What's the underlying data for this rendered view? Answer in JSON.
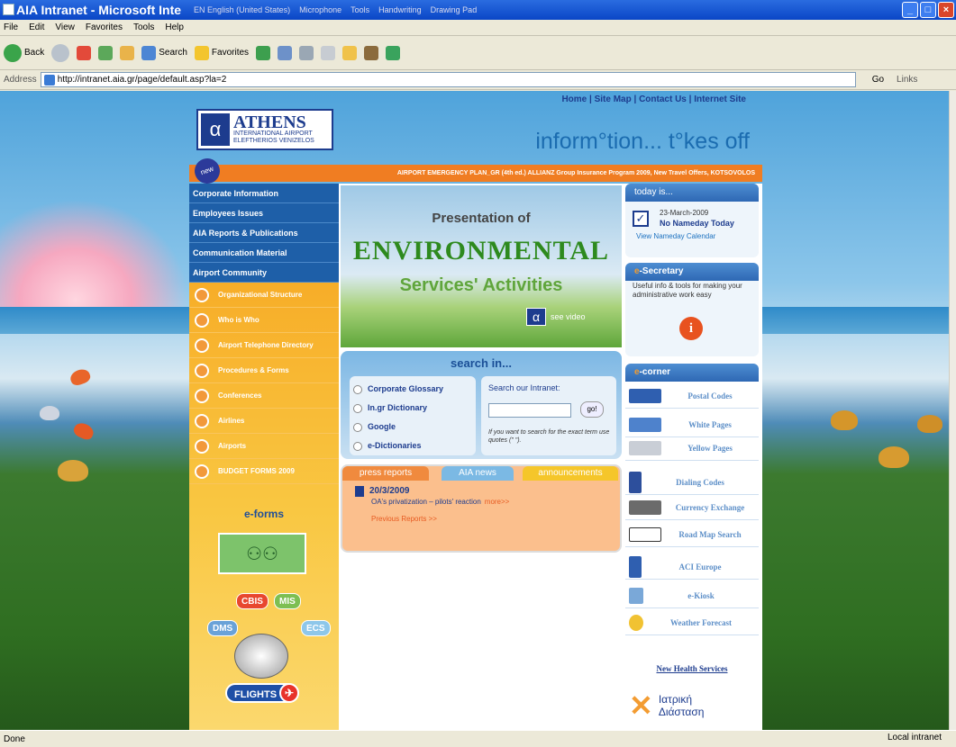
{
  "window": {
    "title": "AIA Intranet - Microsoft Inte",
    "language_bar": [
      "EN English (United States)",
      "Microphone",
      "Tools",
      "Handwriting",
      "Drawing Pad"
    ]
  },
  "menu": [
    "File",
    "Edit",
    "View",
    "Favorites",
    "Tools",
    "Help"
  ],
  "toolbar": {
    "back": "Back",
    "search": "Search",
    "favorites": "Favorites"
  },
  "address": {
    "label": "Address",
    "url": "http://intranet.aia.gr/page/default.asp?la=2",
    "go": "Go",
    "links": "Links"
  },
  "site": {
    "top_links": "Home | Site Map | Contact Us | Internet Site",
    "logo": {
      "name": "ATHENS",
      "line1": "INTERNATIONAL AIRPORT",
      "line2": "ELEFTHERIOS VENIZELOS"
    },
    "tagline": "inform°tion... t°kes off",
    "new_badge": "new",
    "ticker": "AIRPORT EMERGENCY PLAN_GR (4th ed.)  ALLIANZ Group Insurance Program 2009, New Travel Offers, KOTSOVOLOS",
    "left_nav": [
      "Corporate Information",
      "Employees Issues",
      "AIA Reports & Publications",
      "Communication Material",
      "Airport Community"
    ],
    "left_sub": [
      "Organizational Structure",
      "Who is Who",
      "Airport Telephone Directory",
      "Procedures & Forms",
      "Conferences",
      "Airlines",
      "Airports",
      "BUDGET FORMS 2009"
    ],
    "eforms": "e-forms",
    "tools": {
      "cbis": "CBIS",
      "mis": "MIS",
      "dms": "DMS",
      "ecs": "ECS",
      "flights": "FLIGHTS"
    },
    "banner": {
      "line1": "Presentation of",
      "line2": "ENVIRONMENTAL",
      "line3": "Services' Activities",
      "video": "see video"
    },
    "search": {
      "title": "search in...",
      "options": [
        "Corporate Glossary",
        "In.gr Dictionary",
        "Google",
        "e-Dictionaries"
      ],
      "label": "Search our Intranet:",
      "go": "go!",
      "hint": "If you want to search for the exact term use quotes (\" \")."
    },
    "news_tabs": [
      "press reports",
      "AIA news",
      "announcements"
    ],
    "news": {
      "date": "20/3/2009",
      "item": "OA's privatization – pilots' reaction",
      "more": "more>>",
      "previous": "Previous Reports >>"
    },
    "today": {
      "title": "today is...",
      "date": "23-March-2009",
      "nameday": "No Nameday Today",
      "link": "View Nameday Calendar"
    },
    "esecretary": {
      "title_e": "e",
      "title": "-Secretary",
      "text": "Useful info & tools for making your administrative work easy"
    },
    "ecorner": {
      "title_e": "e",
      "title": "-corner",
      "links": [
        "Postal Codes",
        "White Pages",
        "Yellow Pages",
        "Dialing Codes",
        "Currency Exchange",
        "Road Map Search",
        "ACI Europe",
        "e-Kiosk",
        "Weather Forecast"
      ]
    },
    "health": "New Health Services",
    "iatriki": {
      "line1": "Ιατρική",
      "line2": "Διάσταση"
    }
  },
  "status": {
    "text": "Done",
    "zone": "Local intranet"
  }
}
